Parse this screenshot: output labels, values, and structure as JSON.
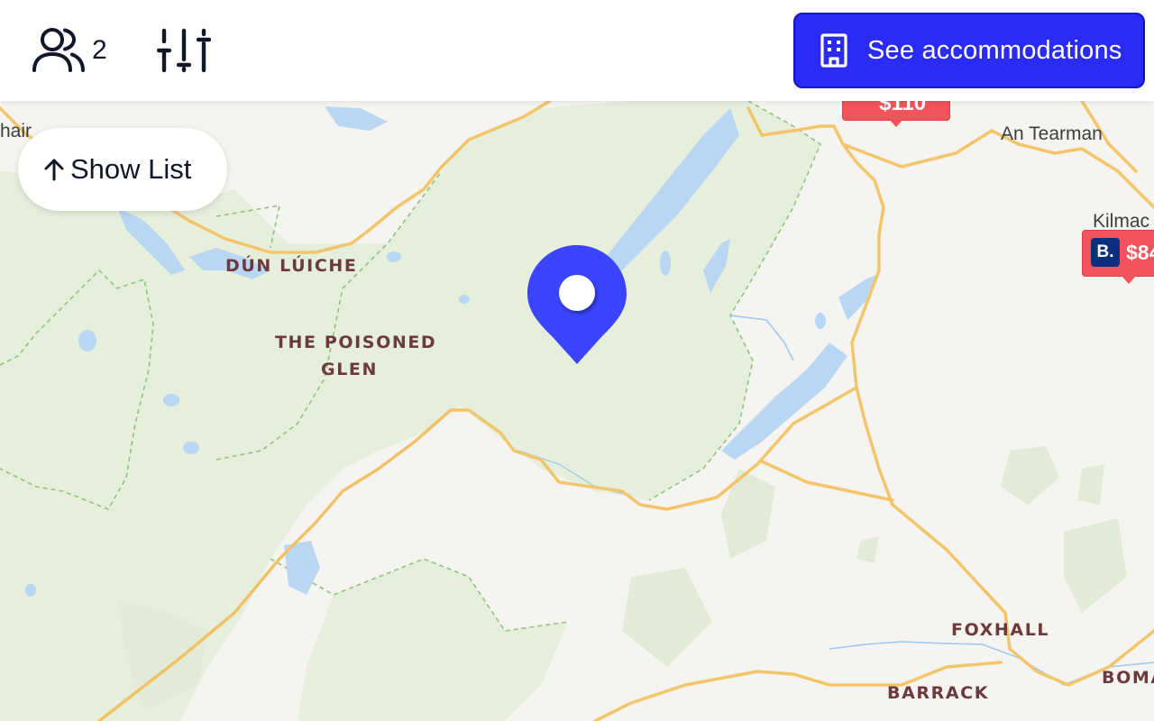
{
  "header": {
    "guest_count": "2",
    "accommodations_label": "See accommodations"
  },
  "controls": {
    "show_list_label": "Show List"
  },
  "map": {
    "labels": {
      "hair": "hair",
      "an_tearman": "An Tearman",
      "kilmac": "Kilmac",
      "dun_luiche": "DÚN LÚICHE",
      "poisoned_glen_1": "THE POISONED",
      "poisoned_glen_2": "GLEN",
      "foxhall": "FOXHALL",
      "barrack": "BARRACK",
      "boma": "BOMA"
    },
    "price_markers": [
      {
        "price": "$84",
        "provider": "B."
      },
      {
        "price": "$110"
      }
    ]
  },
  "colors": {
    "accent": "#2a2bf7",
    "pin": "#3b44ff",
    "price_tag": "#f2545b",
    "park": "#e6eedc",
    "water": "#b9d7f3",
    "road": "#f2c56b",
    "land": "#f6f4f0"
  }
}
